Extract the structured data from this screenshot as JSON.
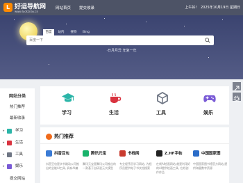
{
  "site": {
    "title": "好运导航网",
    "url": "www.luckznav.cn",
    "logo_char": "L"
  },
  "topnav": {
    "home": "网站首页",
    "submit": "提交收录"
  },
  "topinfo": {
    "greeting": "上午好!",
    "date": "2025年10月19日 星期日"
  },
  "search": {
    "engines": [
      "百度",
      "站内",
      "搜狗",
      "Bing"
    ],
    "placeholder": "百度一下",
    "slogan": "·日月月异 年复一年"
  },
  "sidebar": {
    "title": "网站分类",
    "items": [
      "热门推荐",
      "最新收录",
      "学习",
      "生活",
      "工具",
      "娱乐",
      "提交网站"
    ]
  },
  "categories": [
    {
      "label": "学习",
      "icon": "graduation-cap-icon",
      "color": "#2bb5a8"
    },
    {
      "label": "生活",
      "icon": "coffee-cup-icon",
      "color": "#d9333f"
    },
    {
      "label": "工具",
      "icon": "cube-icon",
      "color": "#6f7684"
    },
    {
      "label": "娱乐",
      "icon": "game-controller-icon",
      "color": "#7a5bd6"
    }
  ],
  "hot": {
    "title": "热门推荐",
    "cards": [
      {
        "name": "抖音豆包",
        "desc": "抖音豆包是字节跳动公司推出的全能AI工具, 具有AI编",
        "color": "#3a7bd5"
      },
      {
        "name": "腾讯元宝",
        "desc": "腾讯元宝是腾讯公司推出的一款基于自研混元大模型",
        "color": "#19b36b"
      },
      {
        "name": "书栈网",
        "desc": "专业程序员学习网站, 为程序员提供电子书文档搜索",
        "color": "#c93b2f"
      },
      {
        "name": "Z.HF字帖",
        "desc": "在线AI绘画网站,就是利用好的AI提供绘画工具, 在线创作作品",
        "color": "#222222"
      },
      {
        "name": "中国国家图",
        "desc": "中国国家图书馆官方网站,提供海量数字资源",
        "color": "#2a6cc8"
      }
    ]
  }
}
